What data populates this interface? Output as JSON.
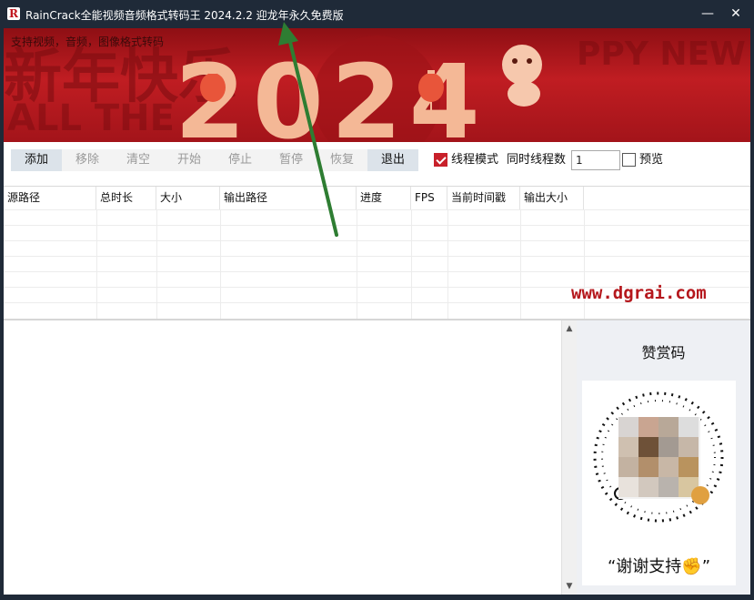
{
  "window": {
    "title": "RainCrack全能视频音频格式转码王 2024.2.2 迎龙年永久免费版",
    "app_icon_glyph": "R",
    "minimize_glyph": "—",
    "close_glyph": "✕"
  },
  "banner": {
    "caption": "支持视频，音频，图像格式转码",
    "year_text": "2024",
    "bg_text_top": "新年快乐",
    "bg_text_mid": "ALL THE",
    "bg_text_right": "PPY NEW",
    "accent_color": "#c01d22",
    "gold_color": "#f4b896"
  },
  "toolbar": {
    "buttons": [
      "添加",
      "移除",
      "清空",
      "开始",
      "停止",
      "暂停",
      "恢复",
      "退出"
    ],
    "thread_mode_label": "线程模式",
    "thread_mode_checked": true,
    "thread_count_label": "同时线程数",
    "thread_count_value": "1",
    "preview_label": "预览",
    "preview_checked": false
  },
  "table": {
    "columns": [
      "源路径",
      "总时长",
      "大小",
      "输出路径",
      "进度",
      "FPS",
      "当前时间戳",
      "输出大小"
    ]
  },
  "watermark": "www.dgrai.com",
  "donate": {
    "title": "赞赏码",
    "thanks": "“谢谢支持✊”"
  },
  "annotation": {
    "arrow_color": "#2e7d32"
  }
}
